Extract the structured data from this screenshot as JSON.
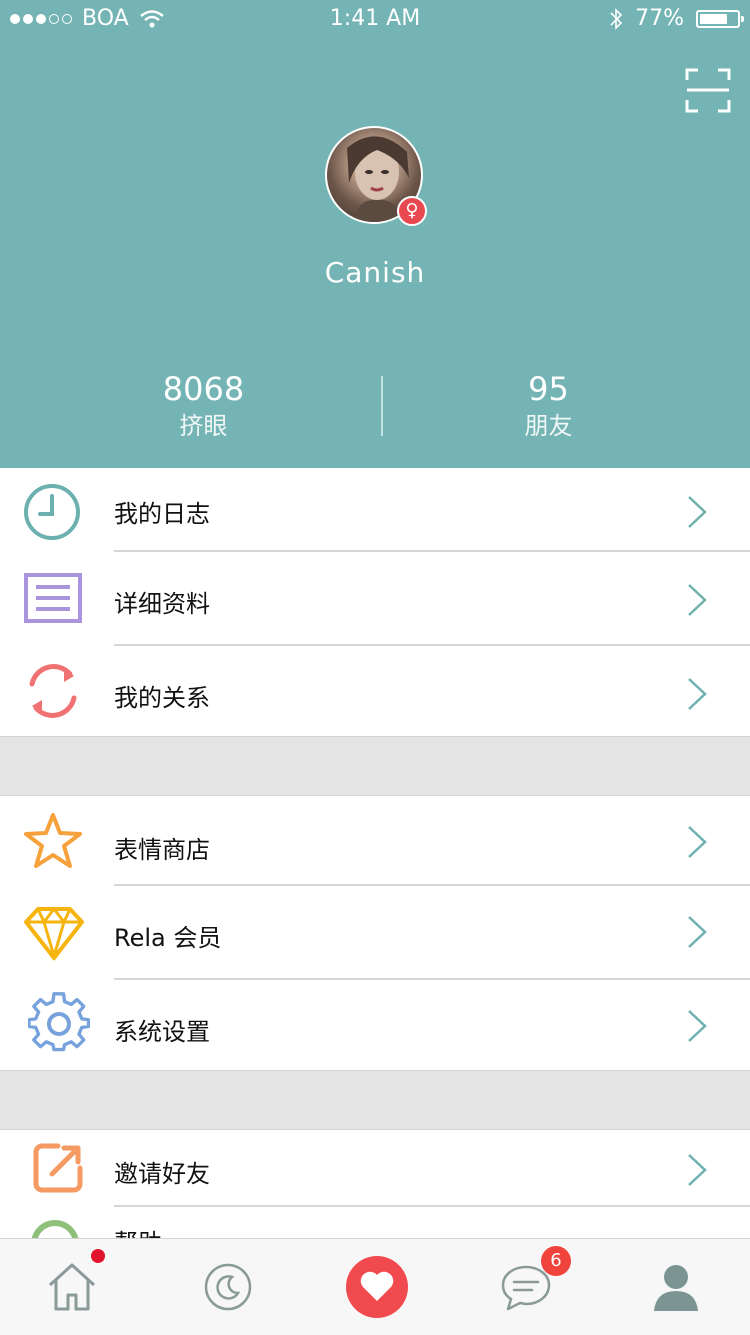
{
  "status_bar": {
    "carrier": "BOA",
    "time": "1:41 AM",
    "battery": "77%",
    "battery_level": 0.77
  },
  "profile": {
    "username": "Canish",
    "gender_symbol": "♀",
    "stats": [
      {
        "value": "8068",
        "label": "挤眼"
      },
      {
        "value": "95",
        "label": "朋友"
      }
    ]
  },
  "menu": {
    "group1": [
      {
        "label": "我的日志",
        "icon": "clock-icon"
      },
      {
        "label": "详细资料",
        "icon": "list-document-icon"
      },
      {
        "label": "我的关系",
        "icon": "refresh-cycle-icon"
      }
    ],
    "group2": [
      {
        "label": "表情商店",
        "icon": "star-icon"
      },
      {
        "label": "Rela 会员",
        "icon": "diamond-icon"
      },
      {
        "label": "系统设置",
        "icon": "gear-icon"
      }
    ],
    "group3": [
      {
        "label": "邀请好友",
        "icon": "share-icon"
      },
      {
        "label": "帮助",
        "icon": "help-icon"
      }
    ]
  },
  "tabbar": {
    "tabs": [
      "home-icon",
      "moon-icon",
      "heart-icon",
      "chat-icon",
      "profile-icon"
    ],
    "message_badge": "6"
  },
  "colors": {
    "header": "#74b4b4",
    "accent_red": "#f0433b",
    "chevron": "#6fb0b0"
  }
}
